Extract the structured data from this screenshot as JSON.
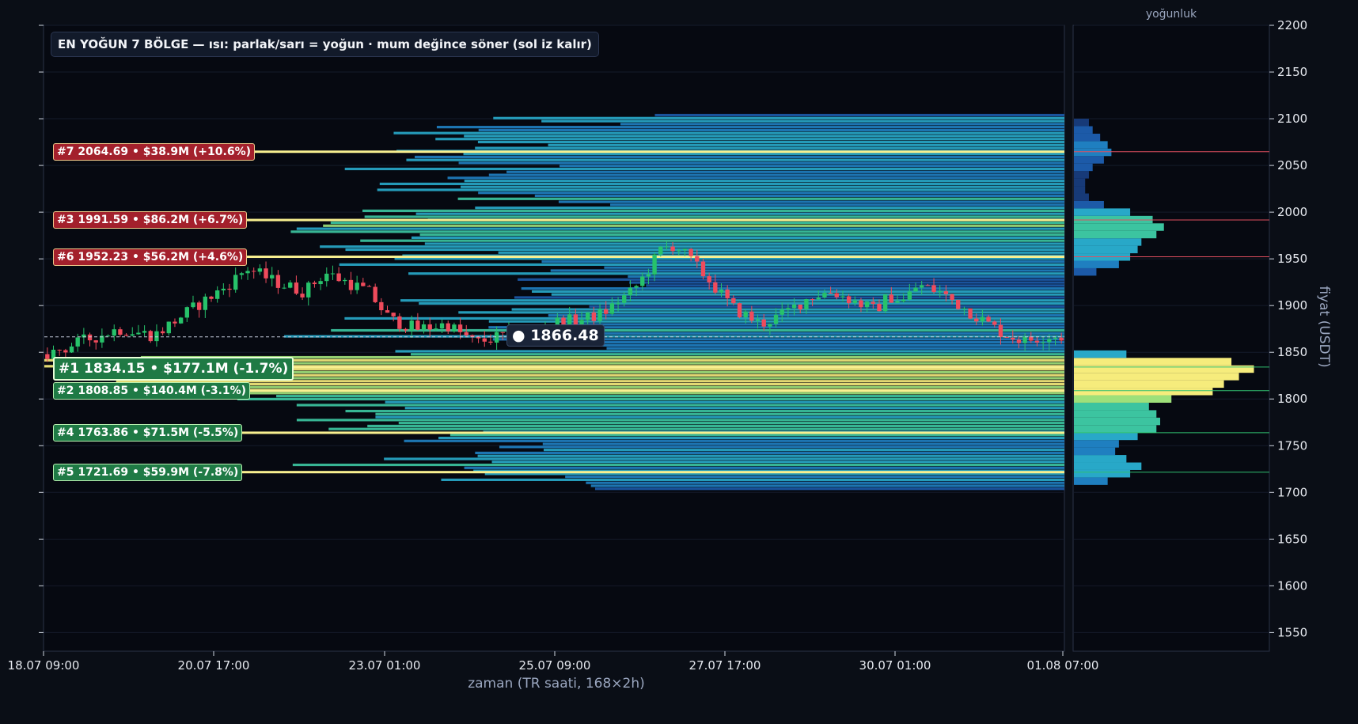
{
  "chart_data": [
    {
      "type": "heatmap",
      "title": "EN YOĞUN 7 BÖLGE — ısı: parlak/sarı = yoğun · mum değince söner (sol iz kalır)",
      "xlabel": "zaman (TR saati, 168×2h)",
      "ylabel": "",
      "ylim": [
        1530,
        2200
      ],
      "y_ticks": [
        "1550",
        "1600",
        "1650",
        "1700",
        "1750",
        "1800",
        "1850",
        "1900",
        "1950",
        "2000",
        "2050",
        "2100",
        "2150",
        "2200"
      ],
      "x_ticks": [
        "18.07 09:00",
        "20.07 17:00",
        "23.07 01:00",
        "25.07 09:00",
        "27.07 17:00",
        "30.07 01:00",
        "01.08 07:00"
      ],
      "current_price": {
        "value": 1866.48,
        "label": "● 1866.48"
      },
      "zones": [
        {
          "rank": 7,
          "price": 2064.69,
          "label": "#7  2064.69  •  $38.9M  (+10.6%)",
          "side": "up"
        },
        {
          "rank": 3,
          "price": 1991.59,
          "label": "#3  1991.59  •  $86.2M  (+6.7%)",
          "side": "up"
        },
        {
          "rank": 6,
          "price": 1952.23,
          "label": "#6  1952.23  •  $56.2M  (+4.6%)",
          "side": "up"
        },
        {
          "rank": 1,
          "price": 1834.15,
          "label": "#1  1834.15  •  $177.1M  (-1.7%)",
          "side": "down"
        },
        {
          "rank": 2,
          "price": 1808.85,
          "label": "#2  1808.85  •  $140.4M  (-3.1%)",
          "side": "down"
        },
        {
          "rank": 4,
          "price": 1763.86,
          "label": "#4  1763.86  •  $71.5M  (-5.5%)",
          "side": "down"
        },
        {
          "rank": 5,
          "price": 1721.69,
          "label": "#5  1721.69  •  $59.9M  (-7.8%)",
          "side": "down"
        }
      ],
      "candles": {
        "count": 168,
        "close_points": [
          [
            0,
            1848
          ],
          [
            10,
            1862
          ],
          [
            20,
            1875
          ],
          [
            30,
            1868
          ],
          [
            40,
            1895
          ],
          [
            50,
            1920
          ],
          [
            56,
            1940
          ],
          [
            64,
            1925
          ],
          [
            72,
            1915
          ],
          [
            78,
            1935
          ],
          [
            84,
            1925
          ],
          [
            90,
            1915
          ],
          [
            96,
            1885
          ],
          [
            104,
            1875
          ],
          [
            112,
            1880
          ],
          [
            120,
            1860
          ],
          [
            128,
            1868
          ],
          [
            136,
            1872
          ],
          [
            142,
            1882
          ],
          [
            150,
            1885
          ],
          [
            156,
            1892
          ],
          [
            160,
            1905
          ],
          [
            164,
            1915
          ],
          [
            168,
            1935
          ],
          [
            172,
            1960
          ],
          [
            176,
            1965
          ],
          [
            180,
            1950
          ],
          [
            186,
            1925
          ],
          [
            192,
            1898
          ],
          [
            200,
            1880
          ],
          [
            206,
            1890
          ],
          [
            214,
            1910
          ],
          [
            220,
            1915
          ],
          [
            226,
            1905
          ],
          [
            232,
            1895
          ],
          [
            236,
            1910
          ],
          [
            240,
            1905
          ],
          [
            244,
            1922
          ],
          [
            250,
            1915
          ],
          [
            256,
            1900
          ],
          [
            262,
            1885
          ],
          [
            268,
            1870
          ],
          [
            274,
            1862
          ],
          [
            280,
            1868
          ],
          [
            286,
            1866
          ]
        ],
        "up_color": "#27c26a",
        "down_color": "#ef4b5c"
      }
    },
    {
      "type": "bar",
      "title": "yoğunluk",
      "orientation": "horizontal",
      "ylim": [
        1530,
        2200
      ],
      "y": [
        1712,
        1720,
        1728,
        1736,
        1744,
        1752,
        1760,
        1768,
        1776,
        1784,
        1792,
        1800,
        1808,
        1816,
        1824,
        1832,
        1840,
        1848,
        1856,
        1864,
        1872,
        1880,
        1888,
        1896,
        1904,
        1912,
        1920,
        1928,
        1936,
        1944,
        1952,
        1960,
        1968,
        1976,
        1984,
        1992,
        2000,
        2008,
        2016,
        2024,
        2032,
        2040,
        2048,
        2056,
        2064,
        2072,
        2080,
        2088,
        2096
      ],
      "values": [
        0.18,
        0.3,
        0.36,
        0.28,
        0.22,
        0.24,
        0.34,
        0.44,
        0.46,
        0.44,
        0.4,
        0.52,
        0.74,
        0.8,
        0.88,
        0.96,
        0.84,
        0.28,
        0.0,
        0.0,
        0.0,
        0.0,
        0.0,
        0.0,
        0.0,
        0.0,
        0.0,
        0.0,
        0.12,
        0.24,
        0.3,
        0.34,
        0.36,
        0.44,
        0.48,
        0.42,
        0.3,
        0.16,
        0.08,
        0.06,
        0.06,
        0.08,
        0.1,
        0.16,
        0.2,
        0.18,
        0.14,
        0.1,
        0.08
      ],
      "zone_lines": [
        2064.69,
        1991.59,
        1952.23,
        1834.15,
        1808.85,
        1763.86,
        1721.69
      ]
    }
  ],
  "colors": {
    "background": "#0a0e16",
    "up_zone": "#e05060",
    "down_zone": "#30c070",
    "heat_low": "#1a3a7a",
    "heat_mid": "#2aa8c8",
    "heat_high": "#f8ee80"
  }
}
